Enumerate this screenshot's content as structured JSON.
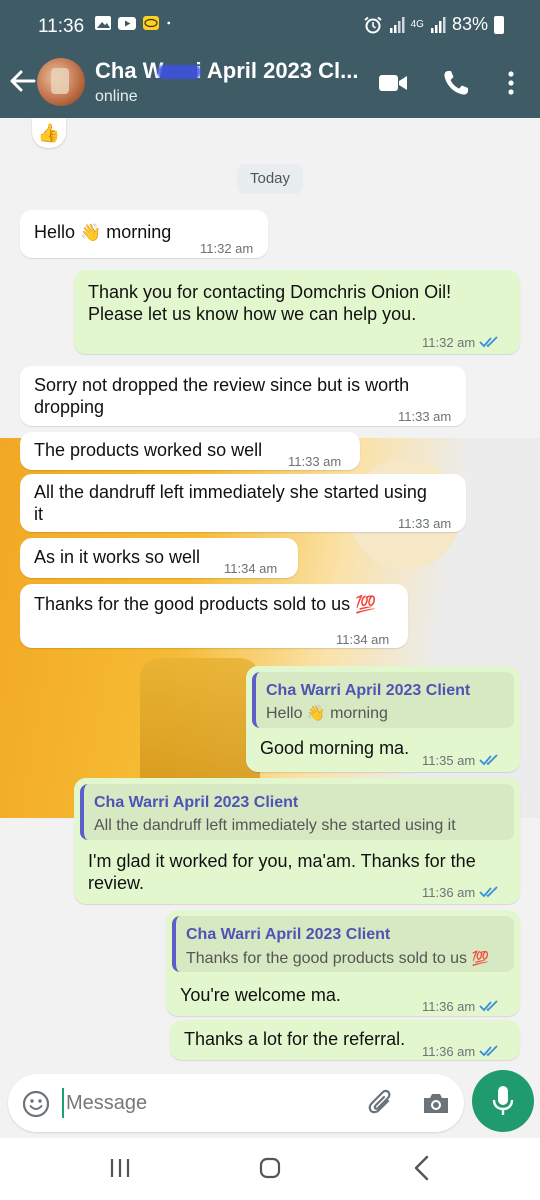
{
  "status_bar": {
    "time": "11:36",
    "network": "4G",
    "battery": "83%"
  },
  "app_bar": {
    "name_before": "Cha W",
    "name_after": "i April 2023 Cl...",
    "status": "online"
  },
  "chat": {
    "reaction": "👍",
    "date_chip": "Today",
    "messages": [
      {
        "text": "Hello",
        "emoji": "👋",
        "text2": "morning",
        "time": "11:32 am"
      },
      {
        "line1": "Thank you for contacting Domchris Onion Oil!",
        "line2": "Please let us know how we can help you.",
        "time": "11:32 am"
      },
      {
        "line1": "Sorry not dropped the review since but is worth",
        "line2": "dropping",
        "time": "11:33 am"
      },
      {
        "text": "The products worked so well",
        "time": "11:33 am"
      },
      {
        "line1": "All the dandruff left immediately she started using",
        "line2": "it",
        "time": "11:33 am"
      },
      {
        "text": "As in it works so well",
        "time": "11:34 am"
      },
      {
        "text": "Thanks for the good products sold to us",
        "emoji": "💯",
        "time": "11:34 am"
      },
      {
        "quote_name": "Cha Warri April 2023 Client",
        "quote_text": "Hello",
        "quote_emoji": "👋",
        "quote_text2": "morning",
        "text": "Good morning ma.",
        "time": "11:35 am"
      },
      {
        "quote_name": "Cha Warri April 2023 Client",
        "quote_text": "All the dandruff left immediately she started using it",
        "line1": "I'm glad it worked for you, ma'am. Thanks for the",
        "line2": "review.",
        "time": "11:36 am"
      },
      {
        "quote_name": "Cha Warri April 2023 Client",
        "quote_text": "Thanks for the good products sold to us",
        "quote_emoji": "💯",
        "text": "You're welcome ma.",
        "time": "11:36 am"
      },
      {
        "text": "Thanks a lot for the referral.",
        "time": "11:36 am"
      }
    ]
  },
  "input": {
    "placeholder": "Message"
  },
  "colors": {
    "header": "#3e5b66",
    "outgoing_bubble": "#e3f7cf",
    "incoming_bubble": "#ffffff",
    "read_ticks": "#3a8fd6",
    "mic_button": "#1f9b6d",
    "quote_accent": "#5b5fc7"
  },
  "icons": [
    "back-arrow-icon",
    "video-call-icon",
    "voice-call-icon",
    "more-options-icon",
    "emoji-icon",
    "attach-icon",
    "camera-icon",
    "mic-icon",
    "recent-apps-icon",
    "home-icon",
    "nav-back-icon"
  ]
}
